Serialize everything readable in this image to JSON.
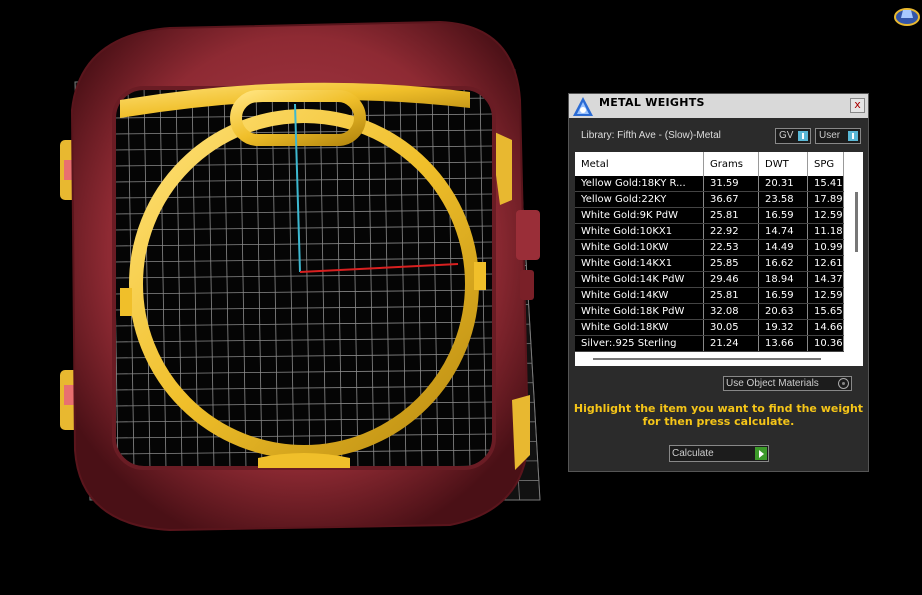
{
  "panel": {
    "title": "METAL WEIGHTS",
    "close_label": "x",
    "library_label": "Library: Fifth Ave - (Slow)-Metal",
    "gv_label": "GV",
    "user_label": "User",
    "use_object_materials": "Use Object Materials",
    "instruction_line1": "Highlight the item you want to find the weight",
    "instruction_line2": "for then press calculate.",
    "calculate_label": "Calculate"
  },
  "table": {
    "headers": [
      "Metal",
      "Grams",
      "DWT",
      "SPG"
    ],
    "rows": [
      [
        "Yellow Gold:18KY R...",
        "31.59",
        "20.31",
        "15.41"
      ],
      [
        "Yellow Gold:22KY",
        "36.67",
        "23.58",
        "17.89"
      ],
      [
        "White Gold:9K PdW",
        "25.81",
        "16.59",
        "12.59"
      ],
      [
        "White Gold:10KX1",
        "22.92",
        "14.74",
        "11.18"
      ],
      [
        "White Gold:10KW",
        "22.53",
        "14.49",
        "10.99"
      ],
      [
        "White Gold:14KX1",
        "25.85",
        "16.62",
        "12.61"
      ],
      [
        "White Gold:14K PdW",
        "29.46",
        "18.94",
        "14.37"
      ],
      [
        "White Gold:14KW",
        "25.81",
        "16.59",
        "12.59"
      ],
      [
        "White Gold:18K PdW",
        "32.08",
        "20.63",
        "15.65"
      ],
      [
        "White Gold:18KW",
        "30.05",
        "19.32",
        "14.66"
      ],
      [
        "Silver:.925 Sterling",
        "21.24",
        "13.66",
        "10.36"
      ]
    ]
  },
  "colors": {
    "background": "#000000",
    "case": "#8e2a33",
    "bezel": "#f2c230",
    "grid": "#8a8a8a",
    "instruction_text": "#f5c518"
  },
  "icons": {
    "viewport_nav": "navigation-cube-icon",
    "panel_logo": "metal-weights-logo-icon"
  }
}
